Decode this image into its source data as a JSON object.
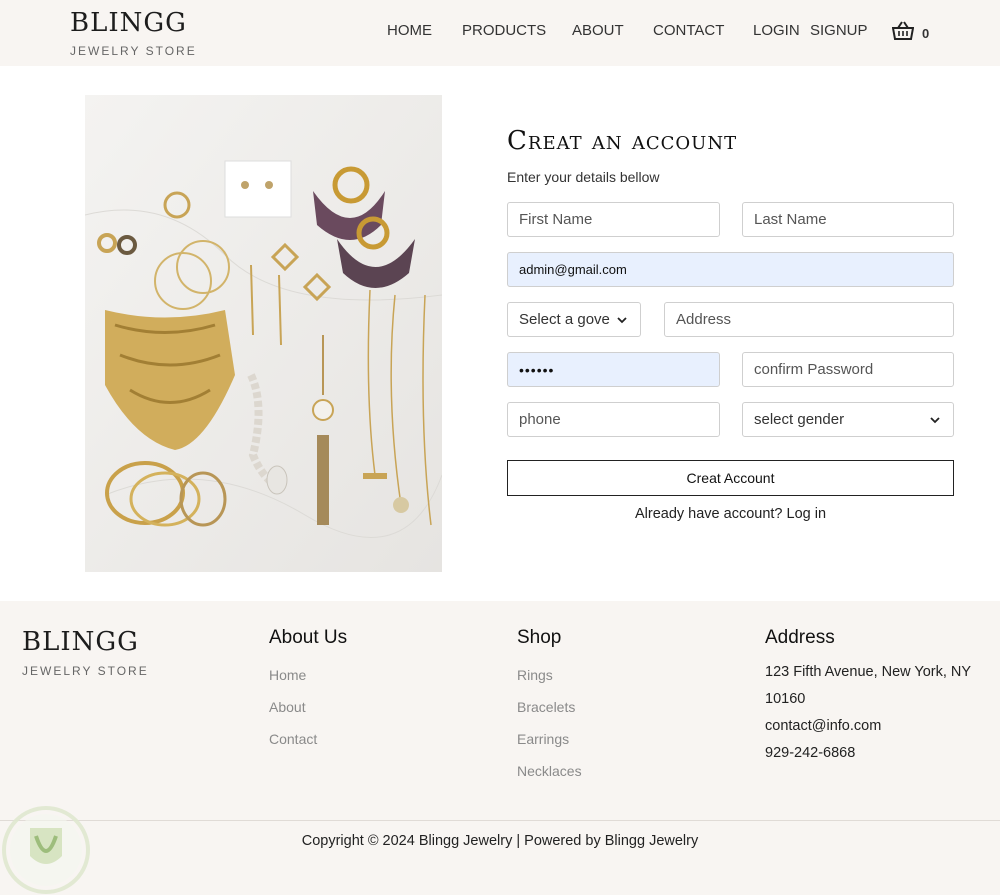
{
  "header": {
    "brand_name": "BLINGG",
    "brand_tag": "JEWELRY STORE",
    "nav": [
      {
        "label": "HOME"
      },
      {
        "label": "PRODUCTS"
      },
      {
        "label": "ABOUT"
      },
      {
        "label": "CONTACT"
      },
      {
        "label": "LOGIN"
      },
      {
        "label": "SIGNUP"
      }
    ],
    "cart_count": "0",
    "cart_icon": "basket-icon"
  },
  "form": {
    "title": "Creat an account",
    "subtitle": "Enter your details bellow",
    "first_name_placeholder": "First Name",
    "last_name_placeholder": "Last Name",
    "email_value": "admin@gmail.com",
    "governorate_selected": "Select a gove",
    "address_placeholder": "Address",
    "password_value": "••••••",
    "confirm_password_placeholder": "confirm Password",
    "phone_placeholder": "phone",
    "gender_selected": "select gender",
    "submit_label": "Creat Account",
    "login_prompt": "Already have account? Log in",
    "autofill_color": "#e8f0fe"
  },
  "footer": {
    "brand_name": "BLINGG",
    "brand_tag": "JEWELRY STORE",
    "about": {
      "title": "About Us",
      "links": [
        "Home",
        "About",
        "Contact"
      ]
    },
    "shop": {
      "title": "Shop",
      "links": [
        "Rings",
        "Bracelets",
        "Earrings",
        "Necklaces"
      ]
    },
    "address": {
      "title": "Address",
      "line1": "123 Fifth Avenue, New York, NY",
      "line2": "10160",
      "email": "contact@info.com",
      "phone": "929-242-6868"
    },
    "copyright": "Copyright © 2024 Blingg Jewelry | Powered by Blingg Jewelry",
    "background": "#f8f5f2"
  }
}
